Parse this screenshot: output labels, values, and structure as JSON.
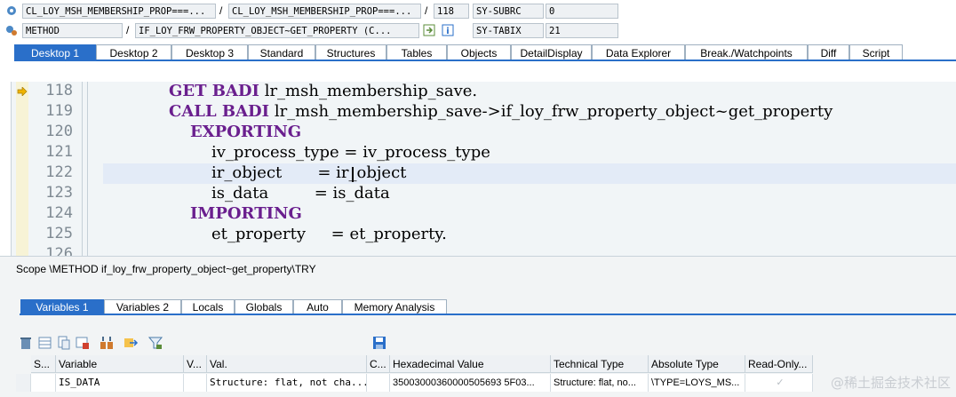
{
  "header": {
    "row1": {
      "program": "CL_LOY_MSH_MEMBERSHIP_PROP===...",
      "include": "CL_LOY_MSH_MEMBERSHIP_PROP===...",
      "line": "118",
      "sysvar": "SY-SUBRC",
      "sysval": "0"
    },
    "row2": {
      "type": "METHOD",
      "event": "IF_LOY_FRW_PROPERTY_OBJECT~GET_PROPERTY (C...",
      "sysvar": "SY-TABIX",
      "sysval": "21"
    },
    "separator": "/"
  },
  "tabs": [
    "Desktop 1",
    "Desktop 2",
    "Desktop 3",
    "Standard",
    "Structures",
    "Tables",
    "Objects",
    "DetailDisplay",
    "Data Explorer",
    "Break./Watchpoints",
    "Diff",
    "Script"
  ],
  "editor": {
    "lines": [
      {
        "no": "118",
        "kw": "GET BADI",
        "rest": " lr_msh_membership_save."
      },
      {
        "no": "119",
        "kw": "CALL BADI",
        "rest": " lr_msh_membership_save->if_loy_frw_property_object~get_property"
      },
      {
        "no": "120",
        "kw": "EXPORTING",
        "rest": ""
      },
      {
        "no": "121",
        "kw": "",
        "rest": "iv_process_type = iv_process_type"
      },
      {
        "no": "122",
        "kw": "",
        "rest": "ir_object       = ir_object"
      },
      {
        "no": "123",
        "kw": "",
        "rest": "is_data         = is_data"
      },
      {
        "no": "124",
        "kw": "IMPORTING",
        "rest": ""
      },
      {
        "no": "125",
        "kw": "",
        "rest": "et_property     = et_property."
      },
      {
        "no": "126",
        "kw": "",
        "rest": ""
      }
    ]
  },
  "scope": "Scope \\METHOD if_loy_frw_property_object~get_property\\TRY",
  "lower_tabs": [
    "Variables 1",
    "Variables 2",
    "Locals",
    "Globals",
    "Auto",
    "Memory Analysis"
  ],
  "toolbar_icons": [
    "delete-icon",
    "insert-row-icon",
    "copy-icon",
    "print-icon",
    "transfer-icon",
    "export-icon",
    "filter-icon",
    "save-icon"
  ],
  "grid": {
    "headers": [
      "S...",
      "Variable",
      "V...",
      "Val.",
      "C...",
      "Hexadecimal Value",
      "Technical Type",
      "Absolute Type",
      "Read-Only..."
    ],
    "row": [
      "",
      "IS_DATA",
      "",
      "Structure: flat, not cha...",
      "",
      "35003000360000505693 5F03...",
      "Structure: flat, no...",
      "\\TYPE=LOYS_MS...",
      "✓"
    ]
  },
  "watermark": "@稀土掘金技术社区",
  "colors": {
    "accent": "#2a6fc9",
    "keyword": "#6a1f8e"
  }
}
